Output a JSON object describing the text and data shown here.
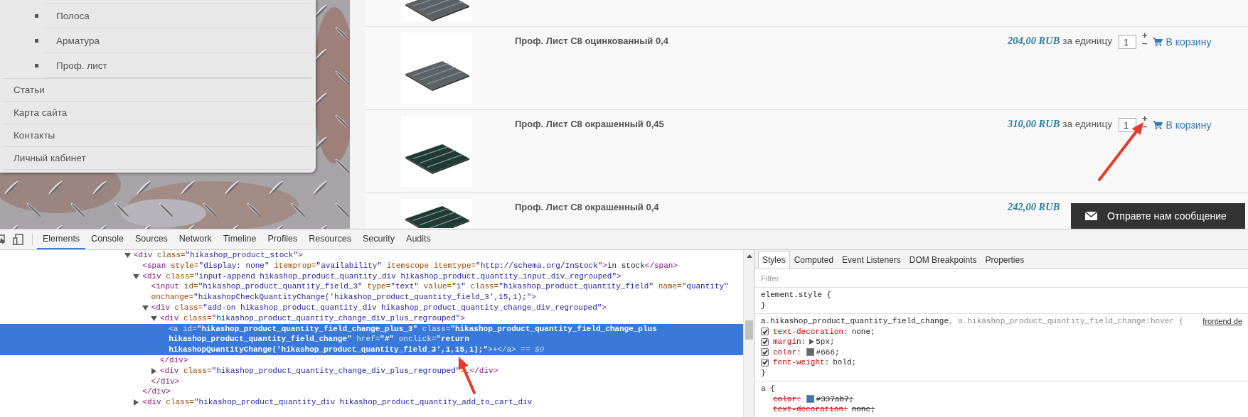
{
  "menu": {
    "submenu": [
      {
        "label": "Полоса"
      },
      {
        "label": "Арматура"
      },
      {
        "label": "Проф. лист"
      }
    ],
    "items": [
      {
        "label": "Статьи"
      },
      {
        "label": "Карта сайта"
      },
      {
        "label": "Контакты"
      },
      {
        "label": "Личный кабинет"
      }
    ]
  },
  "products": [
    {
      "kind": "cut",
      "color": "#5c6165"
    },
    {
      "kind": "full",
      "name": "Проф. Лист С8 оцинкованный 0,4",
      "price": "204,00 RUB",
      "unit": "за единицу",
      "quantity": "1",
      "plus": "+",
      "minus": "–",
      "cart": "В корзину",
      "color": "#5c6367"
    },
    {
      "kind": "full",
      "name": "Проф. Лист С8 окрашенный 0,45",
      "price": "310,00 RUB",
      "unit": "за единицу",
      "quantity": "1",
      "plus": "+",
      "minus": "–",
      "cart": "В корзину",
      "color": "#1e3b34"
    },
    {
      "kind": "full",
      "name": "Проф. Лист С8 окрашенный 0,4",
      "price": "242,00 RUB",
      "color": "#1e3b34"
    }
  ],
  "chat_button": {
    "label": "Отправте нам сообщение"
  },
  "devtools": {
    "tabs": [
      {
        "label": "Elements",
        "selected": true
      },
      {
        "label": "Console",
        "selected": false
      },
      {
        "label": "Sources",
        "selected": false
      },
      {
        "label": "Network",
        "selected": false
      },
      {
        "label": "Timeline",
        "selected": false
      },
      {
        "label": "Profiles",
        "selected": false
      },
      {
        "label": "Resources",
        "selected": false
      },
      {
        "label": "Security",
        "selected": false
      },
      {
        "label": "Audits",
        "selected": false
      }
    ],
    "elements": {
      "nodes": [
        {
          "lines": [
            "<div class=\"hikashop_product_stock\">"
          ],
          "expanded": true,
          "selected": false,
          "children": [
            {
              "lines": [
                "<span style=\"display: none\" itemprop=\"availability\" itemscope itemtype=\"http://schema.org/InStock\">in stock</span>"
              ],
              "selected": false
            },
            {
              "lines": [
                "<div class=\"input-append hikashop_product_quantity_div hikashop_product_quantity_input_div_regrouped\">"
              ],
              "expanded": true,
              "selected": false,
              "close": "</div>",
              "children": [
                {
                  "lines": [
                    "<input id=\"hikashop_product_quantity_field_3\" type=\"text\" value=\"1\" class=\"hikashop_product_quantity_field\" name=\"quantity\"",
                    "onchange=\"hikashopCheckQuantityChange('hikashop_product_quantity_field_3',15,1);\">"
                  ],
                  "selected": false
                },
                {
                  "lines": [
                    "<div class=\"add-on hikashop_product_quantity_div hikashop_product_quantity_change_div_regrouped\">"
                  ],
                  "expanded": true,
                  "selected": false,
                  "close": "</div>",
                  "children": [
                    {
                      "lines": [
                        "<div class=\"hikashop_product_quantity_change_div_plus_regrouped\">"
                      ],
                      "expanded": true,
                      "selected": false,
                      "close": "</div>",
                      "children": [
                        {
                          "lines": [
                            "<a id=\"hikashop_product_quantity_field_change_plus_3\" class=\"hikashop_product_quantity_field_change_plus",
                            "hikashop_product_quantity_field_change\" href=\"#\" onclick=\"return",
                            "hikashopQuantityChange('hikashop_product_quantity_field_3',1,15,1);\">+</a>"
                          ],
                          "suffix": "== $0",
                          "selected": true
                        }
                      ]
                    },
                    {
                      "lines": [
                        "<div class=\"hikashop_product_quantity_change_div_plus_regrouped\">…</div>"
                      ],
                      "expanded": false,
                      "selected": false
                    }
                  ]
                }
              ]
            },
            {
              "lines": [
                "<div class=\"hikashop_product_quantity_div hikashop_product_quantity_add_to_cart_div"
              ],
              "expanded": false,
              "selected": false
            }
          ]
        }
      ]
    },
    "styles": {
      "tabs": [
        {
          "label": "Styles",
          "selected": true
        },
        {
          "label": "Computed",
          "selected": false
        },
        {
          "label": "Event Listeners",
          "selected": false
        },
        {
          "label": "DOM Breakpoints",
          "selected": false
        },
        {
          "label": "Properties",
          "selected": false
        }
      ],
      "filter_placeholder": "Filter",
      "rules": [
        {
          "selector": "element.style {",
          "close": "}"
        },
        {
          "selector": "a.hikashop_product_quantity_field_change",
          "selector_rest": ", a.hikashop_product_quantity_field_change:hover {",
          "source": "frontend de",
          "close": "}",
          "properties": [
            {
              "name": "text-decoration:",
              "value": "none;",
              "checked": true,
              "overridden": false,
              "expandable": false
            },
            {
              "name": "margin:",
              "value": "5px;",
              "checked": true,
              "overridden": false,
              "expandable": true
            },
            {
              "name": "color:",
              "value": "#666;",
              "checked": true,
              "overridden": false,
              "expandable": false,
              "color": "#666666"
            },
            {
              "name": "font-weight:",
              "value": "bold;",
              "checked": true,
              "overridden": false,
              "expandable": false
            }
          ]
        },
        {
          "selector": "a {",
          "properties": [
            {
              "name": "color:",
              "value": "#337ab7;",
              "overridden": true,
              "expandable": false,
              "color": "#337ab7"
            },
            {
              "name": "text-decoration:",
              "value": "none;",
              "overridden": true,
              "expandable": false
            }
          ]
        }
      ]
    }
  },
  "annotations": [
    {
      "kind": "arrow"
    },
    {
      "kind": "arrow"
    }
  ]
}
